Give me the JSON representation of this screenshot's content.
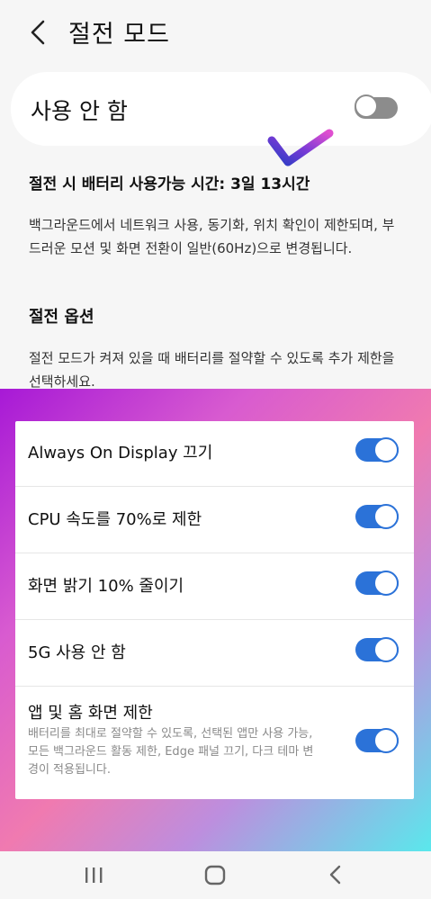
{
  "header": {
    "title": "절전 모드"
  },
  "master": {
    "label": "사용 안 함",
    "enabled": false
  },
  "battery_time": "절전 시 배터리 사용가능 시간: 3일 13시간",
  "description": "백그라운드에서 네트워크 사용, 동기화, 위치 확인이 제한되며, 부드러운 모션 및 화면 전환이 일반(60Hz)으로 변경됩니다.",
  "options_title": "절전 옵션",
  "options_description": "절전 모드가 켜져 있을 때 배터리를 절약할 수 있도록 추가 제한을 선택하세요.",
  "options": [
    {
      "label": "Always On Display 끄기",
      "enabled": true
    },
    {
      "label": "CPU 속도를 70%로 제한",
      "enabled": true
    },
    {
      "label": "화면 밝기 10% 줄이기",
      "enabled": true
    },
    {
      "label": "5G 사용 안 함",
      "enabled": true
    },
    {
      "label": "앱 및 홈 화면 제한",
      "sublabel": "배터리를 최대로 절약할 수 있도록, 선택된 앱만 사용 가능, 모든 백그라운드 활동 제한, Edge 패널 끄기, 다크 테마 변경이 적용됩니다.",
      "enabled": true
    }
  ],
  "colors": {
    "toggle_on": "#2b72d8",
    "toggle_off": "#8c8c8c",
    "accent_check": "#d94bd0"
  },
  "navigation": {
    "recents": "recents-icon",
    "home": "home-icon",
    "back": "back-icon"
  }
}
